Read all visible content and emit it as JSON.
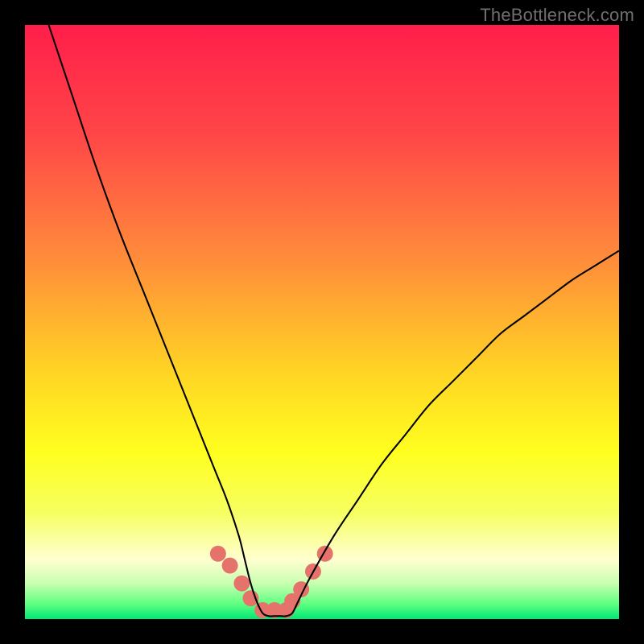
{
  "watermark": "TheBottleneck.com",
  "chart_data": {
    "type": "line",
    "title": "",
    "xlabel": "",
    "ylabel": "",
    "xlim": [
      0,
      100
    ],
    "ylim": [
      0,
      100
    ],
    "series": [
      {
        "name": "bottleneck-curve",
        "x": [
          4,
          8,
          12,
          16,
          20,
          24,
          28,
          30,
          32,
          34,
          36,
          37,
          38,
          39,
          40,
          41,
          42,
          43,
          44,
          45,
          46,
          48,
          52,
          56,
          60,
          64,
          68,
          72,
          76,
          80,
          84,
          88,
          92,
          96,
          100
        ],
        "y": [
          100,
          88,
          76,
          65,
          55,
          45,
          35,
          30,
          25,
          20,
          14,
          10,
          6,
          3,
          1,
          0.5,
          0.5,
          0.5,
          0.5,
          1,
          3,
          7,
          14,
          20,
          26,
          31,
          36,
          40,
          44,
          48,
          51,
          54,
          57,
          59.5,
          62
        ]
      }
    ],
    "markers": {
      "name": "highlight-region",
      "color": "#e5736b",
      "points_x": [
        32.5,
        34.5,
        36.5,
        38,
        40,
        42,
        44,
        45,
        46.5,
        48.5,
        50.5
      ],
      "points_y": [
        11,
        9,
        6,
        3.5,
        1.5,
        1.5,
        1.5,
        3,
        5,
        8,
        11
      ]
    },
    "gradient_stops": [
      {
        "offset": 0.0,
        "color": "#ff1e4b"
      },
      {
        "offset": 0.18,
        "color": "#ff4547"
      },
      {
        "offset": 0.4,
        "color": "#ff8e3a"
      },
      {
        "offset": 0.58,
        "color": "#ffd324"
      },
      {
        "offset": 0.72,
        "color": "#ffff1f"
      },
      {
        "offset": 0.82,
        "color": "#f6ff60"
      },
      {
        "offset": 0.9,
        "color": "#ffffd0"
      },
      {
        "offset": 0.94,
        "color": "#c9ffb0"
      },
      {
        "offset": 0.975,
        "color": "#5eff80"
      },
      {
        "offset": 1.0,
        "color": "#00e874"
      }
    ]
  }
}
